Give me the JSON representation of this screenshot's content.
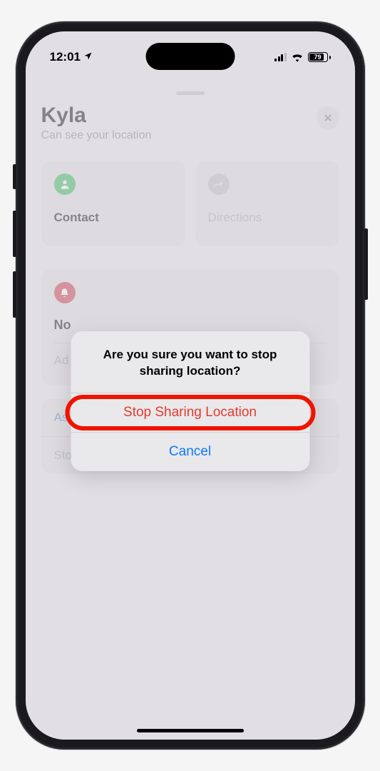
{
  "status_bar": {
    "time": "12:01",
    "battery_pct": "79"
  },
  "header": {
    "name": "Kyla",
    "subtitle": "Can see your location"
  },
  "tiles": {
    "contact": {
      "label": "Contact"
    },
    "directions": {
      "label": "Directions"
    }
  },
  "notifications": {
    "title_truncated": "No",
    "add_truncated": "Ad"
  },
  "list": {
    "ask_truncated": "As",
    "stop_sharing": "Stop Sharing My Location"
  },
  "action_sheet": {
    "title": "Are you sure you want to stop sharing location?",
    "stop": "Stop Sharing Location",
    "cancel": "Cancel"
  }
}
